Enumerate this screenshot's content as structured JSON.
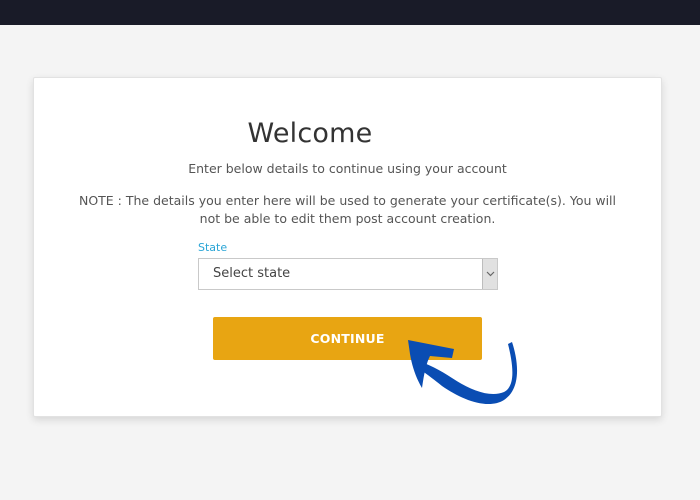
{
  "page": {
    "title": "Welcome",
    "subtitle": "Enter below details to continue using your account",
    "note": "NOTE : The details you enter here will be used to generate your certificate(s). You will not be able to edit them post account creation."
  },
  "form": {
    "state": {
      "label": "State",
      "value": "Select state",
      "icon": "chevron-down-icon"
    },
    "continue_label": "CONTINUE"
  },
  "annotation": {
    "icon": "curved-arrow-icon",
    "color": "#0a4db3"
  },
  "colors": {
    "topbar": "#191b28",
    "background": "#f4f4f4",
    "accent_button": "#e8a512",
    "label_accent": "#2aa5d6"
  }
}
